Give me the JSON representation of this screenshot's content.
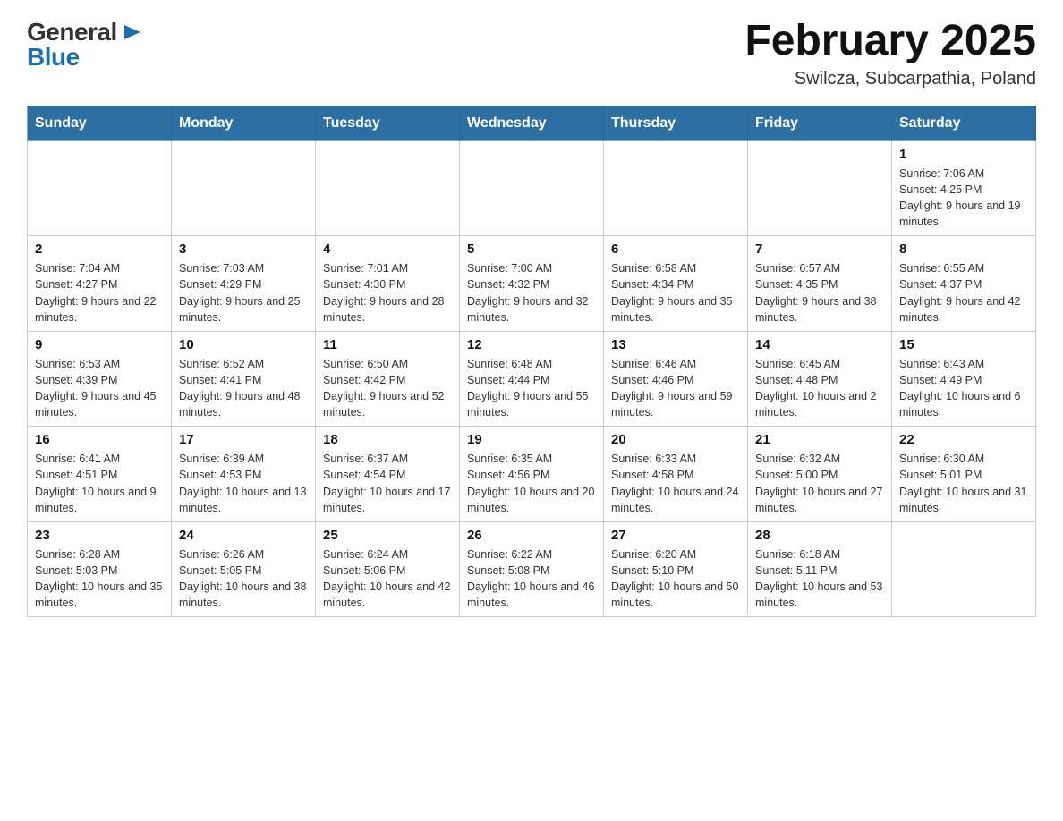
{
  "header": {
    "logo_general": "General",
    "logo_blue": "Blue",
    "title": "February 2025",
    "subtitle": "Swilcza, Subcarpathia, Poland"
  },
  "calendar": {
    "days_of_week": [
      "Sunday",
      "Monday",
      "Tuesday",
      "Wednesday",
      "Thursday",
      "Friday",
      "Saturday"
    ],
    "weeks": [
      [
        {
          "day": "",
          "info": ""
        },
        {
          "day": "",
          "info": ""
        },
        {
          "day": "",
          "info": ""
        },
        {
          "day": "",
          "info": ""
        },
        {
          "day": "",
          "info": ""
        },
        {
          "day": "",
          "info": ""
        },
        {
          "day": "1",
          "info": "Sunrise: 7:06 AM\nSunset: 4:25 PM\nDaylight: 9 hours and 19 minutes."
        }
      ],
      [
        {
          "day": "2",
          "info": "Sunrise: 7:04 AM\nSunset: 4:27 PM\nDaylight: 9 hours and 22 minutes."
        },
        {
          "day": "3",
          "info": "Sunrise: 7:03 AM\nSunset: 4:29 PM\nDaylight: 9 hours and 25 minutes."
        },
        {
          "day": "4",
          "info": "Sunrise: 7:01 AM\nSunset: 4:30 PM\nDaylight: 9 hours and 28 minutes."
        },
        {
          "day": "5",
          "info": "Sunrise: 7:00 AM\nSunset: 4:32 PM\nDaylight: 9 hours and 32 minutes."
        },
        {
          "day": "6",
          "info": "Sunrise: 6:58 AM\nSunset: 4:34 PM\nDaylight: 9 hours and 35 minutes."
        },
        {
          "day": "7",
          "info": "Sunrise: 6:57 AM\nSunset: 4:35 PM\nDaylight: 9 hours and 38 minutes."
        },
        {
          "day": "8",
          "info": "Sunrise: 6:55 AM\nSunset: 4:37 PM\nDaylight: 9 hours and 42 minutes."
        }
      ],
      [
        {
          "day": "9",
          "info": "Sunrise: 6:53 AM\nSunset: 4:39 PM\nDaylight: 9 hours and 45 minutes."
        },
        {
          "day": "10",
          "info": "Sunrise: 6:52 AM\nSunset: 4:41 PM\nDaylight: 9 hours and 48 minutes."
        },
        {
          "day": "11",
          "info": "Sunrise: 6:50 AM\nSunset: 4:42 PM\nDaylight: 9 hours and 52 minutes."
        },
        {
          "day": "12",
          "info": "Sunrise: 6:48 AM\nSunset: 4:44 PM\nDaylight: 9 hours and 55 minutes."
        },
        {
          "day": "13",
          "info": "Sunrise: 6:46 AM\nSunset: 4:46 PM\nDaylight: 9 hours and 59 minutes."
        },
        {
          "day": "14",
          "info": "Sunrise: 6:45 AM\nSunset: 4:48 PM\nDaylight: 10 hours and 2 minutes."
        },
        {
          "day": "15",
          "info": "Sunrise: 6:43 AM\nSunset: 4:49 PM\nDaylight: 10 hours and 6 minutes."
        }
      ],
      [
        {
          "day": "16",
          "info": "Sunrise: 6:41 AM\nSunset: 4:51 PM\nDaylight: 10 hours and 9 minutes."
        },
        {
          "day": "17",
          "info": "Sunrise: 6:39 AM\nSunset: 4:53 PM\nDaylight: 10 hours and 13 minutes."
        },
        {
          "day": "18",
          "info": "Sunrise: 6:37 AM\nSunset: 4:54 PM\nDaylight: 10 hours and 17 minutes."
        },
        {
          "day": "19",
          "info": "Sunrise: 6:35 AM\nSunset: 4:56 PM\nDaylight: 10 hours and 20 minutes."
        },
        {
          "day": "20",
          "info": "Sunrise: 6:33 AM\nSunset: 4:58 PM\nDaylight: 10 hours and 24 minutes."
        },
        {
          "day": "21",
          "info": "Sunrise: 6:32 AM\nSunset: 5:00 PM\nDaylight: 10 hours and 27 minutes."
        },
        {
          "day": "22",
          "info": "Sunrise: 6:30 AM\nSunset: 5:01 PM\nDaylight: 10 hours and 31 minutes."
        }
      ],
      [
        {
          "day": "23",
          "info": "Sunrise: 6:28 AM\nSunset: 5:03 PM\nDaylight: 10 hours and 35 minutes."
        },
        {
          "day": "24",
          "info": "Sunrise: 6:26 AM\nSunset: 5:05 PM\nDaylight: 10 hours and 38 minutes."
        },
        {
          "day": "25",
          "info": "Sunrise: 6:24 AM\nSunset: 5:06 PM\nDaylight: 10 hours and 42 minutes."
        },
        {
          "day": "26",
          "info": "Sunrise: 6:22 AM\nSunset: 5:08 PM\nDaylight: 10 hours and 46 minutes."
        },
        {
          "day": "27",
          "info": "Sunrise: 6:20 AM\nSunset: 5:10 PM\nDaylight: 10 hours and 50 minutes."
        },
        {
          "day": "28",
          "info": "Sunrise: 6:18 AM\nSunset: 5:11 PM\nDaylight: 10 hours and 53 minutes."
        },
        {
          "day": "",
          "info": ""
        }
      ]
    ]
  }
}
